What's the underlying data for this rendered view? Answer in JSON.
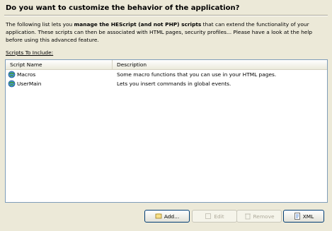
{
  "header": {
    "title": "Do you want to customize the behavior of the application?"
  },
  "description": {
    "part1": "The following list lets you ",
    "bold": "manage the HEScript (and not PHP) scripts",
    "part2": " that can extend the functionality of your application. These scripts can then be associated with HTML pages, security profiles... Please have a look at the help before using this advanced feature."
  },
  "list": {
    "label": "Scripts To Include:",
    "columns": [
      "Script Name",
      "Description"
    ],
    "rows": [
      {
        "name": "Macros",
        "description": "Some macro functions that you can use in your HTML pages.",
        "icon": "script-icon"
      },
      {
        "name": "UserMain",
        "description": "Lets you insert commands in global events.",
        "icon": "script-icon"
      }
    ]
  },
  "buttons": {
    "add": "Add...",
    "edit": "Edit",
    "remove": "Remove",
    "xml": "XML"
  },
  "colors": {
    "background": "#ECE9D8",
    "list_border": "#7F9DB9",
    "disabled_text": "#ACA899"
  }
}
